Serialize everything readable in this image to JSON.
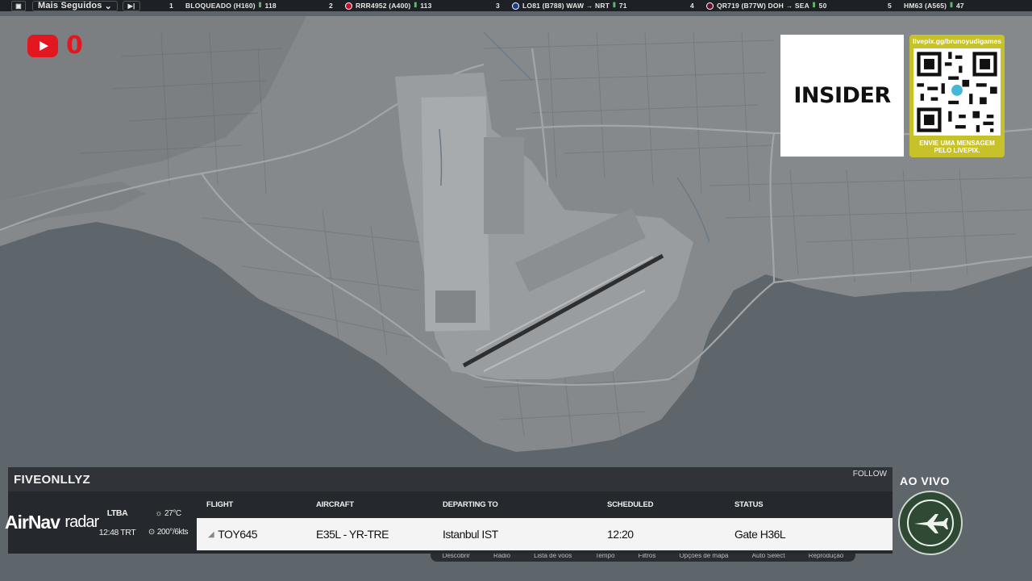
{
  "topbar": {
    "dropdown_label": "Mais Seguidos",
    "items": [
      {
        "rank": "1",
        "callsign": "BLOQUEADO (H160)",
        "route": "",
        "viewers": "118",
        "dot": ""
      },
      {
        "rank": "2",
        "callsign": "RRR4952 (A400)",
        "route": "",
        "viewers": "113",
        "dot": "#c8102e"
      },
      {
        "rank": "3",
        "callsign": "LO81 (B788) WAW → NRT",
        "route": "",
        "viewers": "71",
        "dot": "#1a3c8a"
      },
      {
        "rank": "4",
        "callsign": "QR719 (B77W) DOH → SEA",
        "route": "",
        "viewers": "50",
        "dot": "#6a0d2a"
      },
      {
        "rank": "5",
        "callsign": "HM63 (A565)",
        "route": "",
        "viewers": "47",
        "dot": ""
      }
    ]
  },
  "youtube": {
    "count": "0"
  },
  "sponsor": {
    "name": "INSIDER"
  },
  "qr": {
    "url": "livepix.gg/brunoyudigames",
    "message": "ENVIE UMA MENSAGEM PELO LIVEPIX."
  },
  "panel": {
    "title": "FIVEONLLYZ",
    "follow": "FOLLOW",
    "logo_main": "AirNav",
    "logo_sub": "radar",
    "airport_code": "LTBA",
    "local_time": "12:48 TRT",
    "temperature": "27°C",
    "wind": "200°/6kts",
    "headers": {
      "flight": "FLIGHT",
      "aircraft": "AIRCRAFT",
      "departing": "DEPARTING TO",
      "scheduled": "SCHEDULED",
      "status": "STATUS"
    },
    "row": {
      "flight": "TOY645",
      "aircraft": "E35L - YR-TRE",
      "departing": "Istanbul IST",
      "scheduled": "12:20",
      "status": "Gate H36L"
    }
  },
  "toolbar": {
    "items": [
      "Descobrir",
      "Rádio",
      "Lista de voos",
      "Tempo",
      "Filtros",
      "Opções de mapa",
      "Auto Select",
      "Reprodução"
    ]
  },
  "live": {
    "label": "AO VIVO"
  },
  "colors": {
    "youtube_red": "#e3171f",
    "qr_bg": "#c7c22a",
    "panel_dark": "#25292d",
    "sea": "#5f666b",
    "land": "#8b8e90"
  }
}
